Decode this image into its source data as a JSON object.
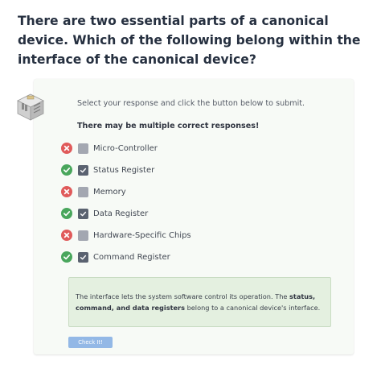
{
  "question": {
    "text": "There are two essential parts of a canonical device. Which of the following belong within the interface of the canonical device?"
  },
  "widget": {
    "instructions": "Select your response and click the button below to submit.",
    "multi_note": "There may be multiple correct responses!",
    "options": [
      {
        "label": "Micro-Controller",
        "checked": false,
        "result": "incorrect",
        "result_icon": "x-circle-icon"
      },
      {
        "label": "Status Register",
        "checked": true,
        "result": "correct",
        "result_icon": "check-circle-icon"
      },
      {
        "label": "Memory",
        "checked": false,
        "result": "incorrect",
        "result_icon": "x-circle-icon"
      },
      {
        "label": "Data Register",
        "checked": true,
        "result": "correct",
        "result_icon": "check-circle-icon"
      },
      {
        "label": "Hardware-Specific Chips",
        "checked": false,
        "result": "incorrect",
        "result_icon": "x-circle-icon"
      },
      {
        "label": "Command Register",
        "checked": true,
        "result": "correct",
        "result_icon": "check-circle-icon"
      }
    ],
    "feedback": {
      "before": "The interface lets the system software control its operation. The ",
      "bold": "status, command, and data registers",
      "after": " belong to a canonical device's interface."
    },
    "check_button_label": "Check It!"
  },
  "colors": {
    "correct": "#49a65c",
    "incorrect": "#e05a5a",
    "checkbox_checked": "#5a6270",
    "checkbox_unchecked": "#a3a7b1",
    "button": "#93b8e6",
    "feedback_bg": "#e4f0e0"
  }
}
